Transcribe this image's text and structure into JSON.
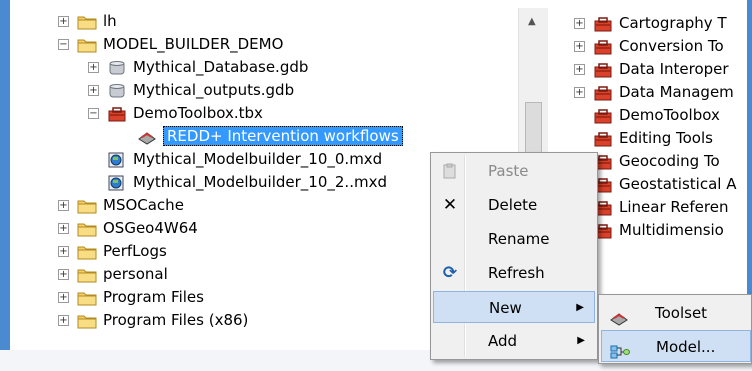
{
  "left_tree": {
    "items": [
      {
        "label": "lh",
        "icon": "folder-icon",
        "expander": "+",
        "depth": 0
      },
      {
        "label": "MODEL_BUILDER_DEMO",
        "icon": "folder-icon",
        "expander": "−",
        "depth": 0
      },
      {
        "label": "Mythical_Database.gdb",
        "icon": "database-icon",
        "expander": "+",
        "depth": 1
      },
      {
        "label": "Mythical_outputs.gdb",
        "icon": "database-icon",
        "expander": "+",
        "depth": 1
      },
      {
        "label": "DemoToolbox.tbx",
        "icon": "toolbox-icon",
        "expander": "−",
        "depth": 1
      },
      {
        "label": "REDD+ Intervention workflows",
        "icon": "model-icon",
        "expander": "",
        "depth": 2,
        "selected": true
      },
      {
        "label": "Mythical_Modelbuilder_10_0.mxd",
        "icon": "map-document-icon",
        "expander": "",
        "depth": 1
      },
      {
        "label": "Mythical_Modelbuilder_10_2..mxd",
        "icon": "map-document-icon",
        "expander": "",
        "depth": 1
      },
      {
        "label": "MSOCache",
        "icon": "folder-icon",
        "expander": "+",
        "depth": 0
      },
      {
        "label": "OSGeo4W64",
        "icon": "folder-icon",
        "expander": "+",
        "depth": 0
      },
      {
        "label": "PerfLogs",
        "icon": "folder-icon",
        "expander": "+",
        "depth": 0
      },
      {
        "label": "personal",
        "icon": "folder-icon",
        "expander": "+",
        "depth": 0
      },
      {
        "label": "Program Files",
        "icon": "folder-icon",
        "expander": "+",
        "depth": 0
      },
      {
        "label": "Program Files (x86)",
        "icon": "folder-icon",
        "expander": "+",
        "depth": 0
      }
    ]
  },
  "right_tree": {
    "items": [
      {
        "label": "Cartography T",
        "expander": "+"
      },
      {
        "label": "Conversion To",
        "expander": "+"
      },
      {
        "label": "Data Interoper",
        "expander": "+"
      },
      {
        "label": "Data Managem",
        "expander": "+"
      },
      {
        "label": "DemoToolbox",
        "expander": ""
      },
      {
        "label": "Editing Tools",
        "expander": ""
      },
      {
        "label": "Geocoding To",
        "expander": ""
      },
      {
        "label": "Geostatistical A",
        "expander": ""
      },
      {
        "label": "Linear Referen",
        "expander": ""
      },
      {
        "label": "Multidimensio",
        "expander": ""
      }
    ]
  },
  "context_menu": {
    "items": [
      {
        "label": "Paste",
        "icon": "paste-icon",
        "disabled": true
      },
      {
        "label": "Delete",
        "icon": "delete-icon"
      },
      {
        "label": "Rename",
        "icon": ""
      },
      {
        "label": "Refresh",
        "icon": "refresh-icon"
      },
      {
        "label": "New",
        "icon": "",
        "submenu": true,
        "hover": true
      },
      {
        "label": "Add",
        "icon": "",
        "submenu": true
      }
    ]
  },
  "submenu": {
    "items": [
      {
        "label": "Toolset",
        "icon": "toolset-icon"
      },
      {
        "label": "Model...",
        "icon": "model-builder-icon",
        "hover": true
      }
    ]
  },
  "colors": {
    "selection": "#3399ff",
    "frame": "#4a8ad0",
    "menu_hover": "#cfe0f4"
  }
}
